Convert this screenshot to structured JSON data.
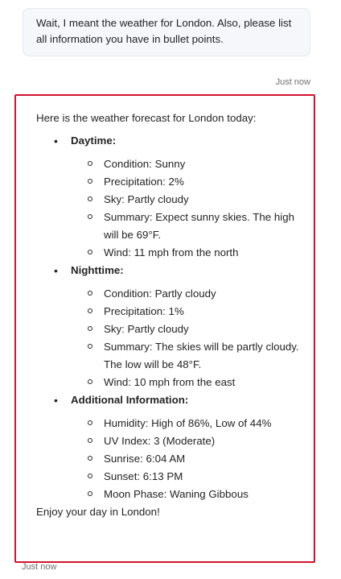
{
  "user_message": {
    "text": "Wait, I meant the weather for London. Also, please list all information you have in bullet points.",
    "timestamp": "Just now"
  },
  "bot_message": {
    "intro": "Here is the weather forecast for London today:",
    "sections": [
      {
        "title": "Daytime:",
        "items": [
          "Condition: Sunny",
          "Precipitation: 2%",
          "Sky: Partly cloudy",
          "Summary: Expect sunny skies. The high will be 69°F.",
          "Wind: 11 mph from the north"
        ]
      },
      {
        "title": "Nighttime:",
        "items": [
          "Condition: Partly cloudy",
          "Precipitation: 1%",
          "Sky: Partly cloudy",
          "Summary: The skies will be partly cloudy. The low will be 48°F.",
          "Wind: 10 mph from the east"
        ]
      },
      {
        "title": "Additional Information:",
        "items": [
          "Humidity: High of 86%, Low of 44%",
          "UV Index: 3 (Moderate)",
          "Sunrise: 6:04 AM",
          "Sunset: 6:13 PM",
          "Moon Phase: Waning Gibbous"
        ]
      }
    ],
    "outro": "Enjoy your day in London!",
    "timestamp": "Just now",
    "highlight_color": "#d3122c"
  }
}
